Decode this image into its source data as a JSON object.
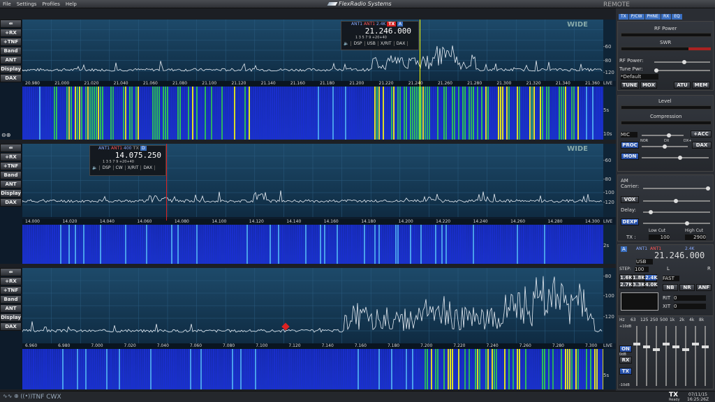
{
  "menu": [
    "File",
    "Settings",
    "Profiles",
    "Help"
  ],
  "brand": "FlexRadio Systems",
  "remote": "REMOTE",
  "side_buttons": [
    "+RX",
    "+TNF",
    "Band",
    "ANT",
    "Display",
    "DAX"
  ],
  "panels": [
    {
      "mode": "WIDE",
      "ticks": [
        "20.980",
        "21.000",
        "21.020",
        "21.040",
        "21.060",
        "21.080",
        "21.100",
        "21.120",
        "21.140",
        "21.160",
        "21.180",
        "21.200",
        "21.220",
        "21.240",
        "21.260",
        "21.280",
        "21.300",
        "21.320",
        "21.340",
        "21.360"
      ],
      "db": [
        "-60",
        "-80",
        "-120"
      ],
      "wf_times": [
        "5s",
        "10s"
      ]
    },
    {
      "mode": "WIDE",
      "ticks": [
        "14.000",
        "14.020",
        "14.040",
        "14.060",
        "14.080",
        "14.100",
        "14.120",
        "14.140",
        "14.160",
        "14.180",
        "14.200",
        "14.220",
        "14.240",
        "14.260",
        "14.280",
        "14.300"
      ],
      "db": [
        "-60",
        "-80",
        "-100",
        "-120"
      ],
      "wf_times": [
        "2s"
      ]
    },
    {
      "mode": "",
      "ticks": [
        "6.960",
        "6.980",
        "7.000",
        "7.020",
        "7.040",
        "7.060",
        "7.080",
        "7.100",
        "7.120",
        "7.140",
        "7.160",
        "7.180",
        "7.200",
        "7.220",
        "7.240",
        "7.260",
        "7.280",
        "7.300"
      ],
      "db": [
        "-80",
        "-100",
        "-120"
      ],
      "wf_times": [
        "5s"
      ]
    }
  ],
  "live": "LIVE",
  "slice1": {
    "ant1": "ANT1",
    "ant2": "ANT1",
    "bw": "2.4K",
    "tx": "TX",
    "letter": "A",
    "freq": "21.246.000",
    "btns": [
      "DSP",
      "USB",
      "X/RIT",
      "DAX"
    ],
    "nums": [
      "1",
      "3",
      "5",
      "7",
      "9",
      "+20",
      "+40"
    ]
  },
  "slice2": {
    "ant1": "ANT1",
    "ant2": "ANT1",
    "bw": "400",
    "tx": "TX",
    "letter": "D",
    "freq": "14.075.250",
    "btns": [
      "DSP",
      "CW",
      "X/RIT",
      "DAX"
    ],
    "nums": [
      "1",
      "3",
      "5",
      "7",
      "9",
      "+20",
      "+40"
    ]
  },
  "tabs": [
    "TX",
    "P/CW",
    "PHNE",
    "RX",
    "EQ"
  ],
  "tx": {
    "rf_power_meter": "RF Power",
    "swr": "SWR",
    "rf_power": "RF Power:",
    "tune_pwr": "Tune Pwr:",
    "profile": "*Default",
    "btns": [
      "TUNE",
      "MOX",
      "ATU",
      "MEM"
    ]
  },
  "mic": {
    "level": "Level",
    "compression": "Compression",
    "mic": "MIC",
    "acc": "+ACC",
    "proc": "PROC",
    "dax": "DAX",
    "mon": "MON",
    "nor": "NOR",
    "dx": "DX",
    "dxp": "DX+"
  },
  "phone": {
    "am_carrier": "AM Carrier:",
    "vox": "VOX",
    "delay": "Delay:",
    "dexp": "DEXP",
    "low_cut": "Low Cut",
    "high_cut": "High Cut",
    "tx": "TX :",
    "low_val": "100",
    "high_val": "2900"
  },
  "rxpanel": {
    "letter": "A",
    "ant1": "ANT1",
    "ant2": "ANT1",
    "bw": "2.4K",
    "freq": "21.246.000",
    "mode": "USB",
    "step_label": "STEP:",
    "step": "100",
    "filters": [
      "1.6K",
      "1.8K",
      "2.4K",
      "2.7K",
      "3.3K",
      "4.0K"
    ],
    "agc": "FAST",
    "nb": "NB",
    "nr": "NR",
    "anf": "ANF",
    "rit": "RIT",
    "xit": "XIT",
    "rit_val": "0",
    "xit_val": "0",
    "l": "L",
    "r": "R"
  },
  "eq": {
    "hz": "Hz",
    "bands": [
      "63",
      "125",
      "250",
      "500",
      "1k",
      "2k",
      "4k",
      "8k"
    ],
    "top": "+10dB",
    "mid": "0dB",
    "bottom": "-10dB",
    "on": "ON",
    "rx": "RX",
    "txb": "TX"
  },
  "status": {
    "tnf": "TNF CWX",
    "tx": "TX",
    "ready": "Ready",
    "date": "07/11/15",
    "time": "16:25:26Z"
  }
}
